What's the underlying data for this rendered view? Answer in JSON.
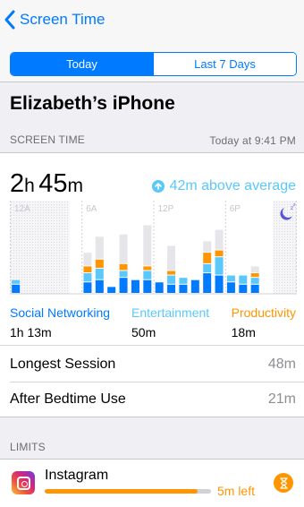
{
  "nav": {
    "back_label": "Screen Time"
  },
  "segments": [
    {
      "label": "Today",
      "active": true
    },
    {
      "label": "Last 7 Days",
      "active": false
    }
  ],
  "device": {
    "title": "Elizabeth’s iPhone"
  },
  "screen_time": {
    "section_label": "SCREEN TIME",
    "timestamp": "Today at 9:41 PM",
    "total_hours": "2",
    "total_hours_unit": "h",
    "total_minutes": "45",
    "total_minutes_unit": "m",
    "comparison": "42m above average"
  },
  "chart_data": {
    "type": "bar",
    "stacked": true,
    "tick_labels": [
      "12A",
      "6A",
      "12P",
      "6P"
    ],
    "categories": [
      "0",
      "1",
      "2",
      "3",
      "4",
      "5",
      "6",
      "7",
      "8",
      "9",
      "10",
      "11",
      "12",
      "13",
      "14",
      "15",
      "16",
      "17",
      "18",
      "19",
      "20",
      "21",
      "22",
      "23"
    ],
    "series": [
      {
        "name": "Social Networking",
        "color": "#007aff",
        "values": [
          4,
          0,
          0,
          0,
          0,
          0,
          5,
          6,
          3,
          7,
          6,
          6,
          5,
          4,
          4,
          6,
          9,
          8,
          5,
          4,
          4,
          0,
          0,
          0
        ]
      },
      {
        "name": "Entertainment",
        "color": "#5ac8fa",
        "values": [
          2,
          0,
          0,
          0,
          0,
          0,
          4,
          5,
          0,
          3,
          0,
          4,
          0,
          4,
          3,
          0,
          4,
          8,
          3,
          4,
          3,
          0,
          0,
          0
        ]
      },
      {
        "name": "Productivity",
        "color": "#ff9500",
        "values": [
          0,
          0,
          0,
          0,
          0,
          0,
          3,
          4,
          0,
          3,
          0,
          2,
          0,
          2,
          0,
          0,
          5,
          3,
          0,
          0,
          2,
          0,
          0,
          0
        ]
      },
      {
        "name": "Other",
        "color": "#e5e5ea",
        "values": [
          0,
          0,
          0,
          0,
          0,
          0,
          6,
          10,
          0,
          13,
          0,
          18,
          0,
          11,
          0,
          0,
          5,
          9,
          0,
          0,
          3,
          0,
          0,
          0
        ]
      }
    ],
    "ylim": [
      0,
      40
    ],
    "shaded_ranges": [
      [
        0,
        5
      ],
      [
        22,
        24
      ]
    ],
    "night_icon": "moon-zzz-icon",
    "grid": true
  },
  "legend": [
    {
      "name": "Social Networking",
      "value": "1h 13m",
      "color": "#007aff"
    },
    {
      "name": "Entertainment",
      "value": "50m",
      "color": "#5ac8fa"
    },
    {
      "name": "Productivity",
      "value": "18m",
      "color": "#ff9500"
    }
  ],
  "stats": [
    {
      "label": "Longest Session",
      "value": "48m"
    },
    {
      "label": "After Bedtime Use",
      "value": "21m"
    }
  ],
  "limits": {
    "section_label": "LIMITS",
    "items": [
      {
        "app": "Instagram",
        "icon": "instagram-icon",
        "remaining": "5m left",
        "progress": 0.92
      }
    ]
  },
  "colors": {
    "accent": "#007aff",
    "warning": "#ff9500",
    "teal": "#5ac8fa"
  }
}
